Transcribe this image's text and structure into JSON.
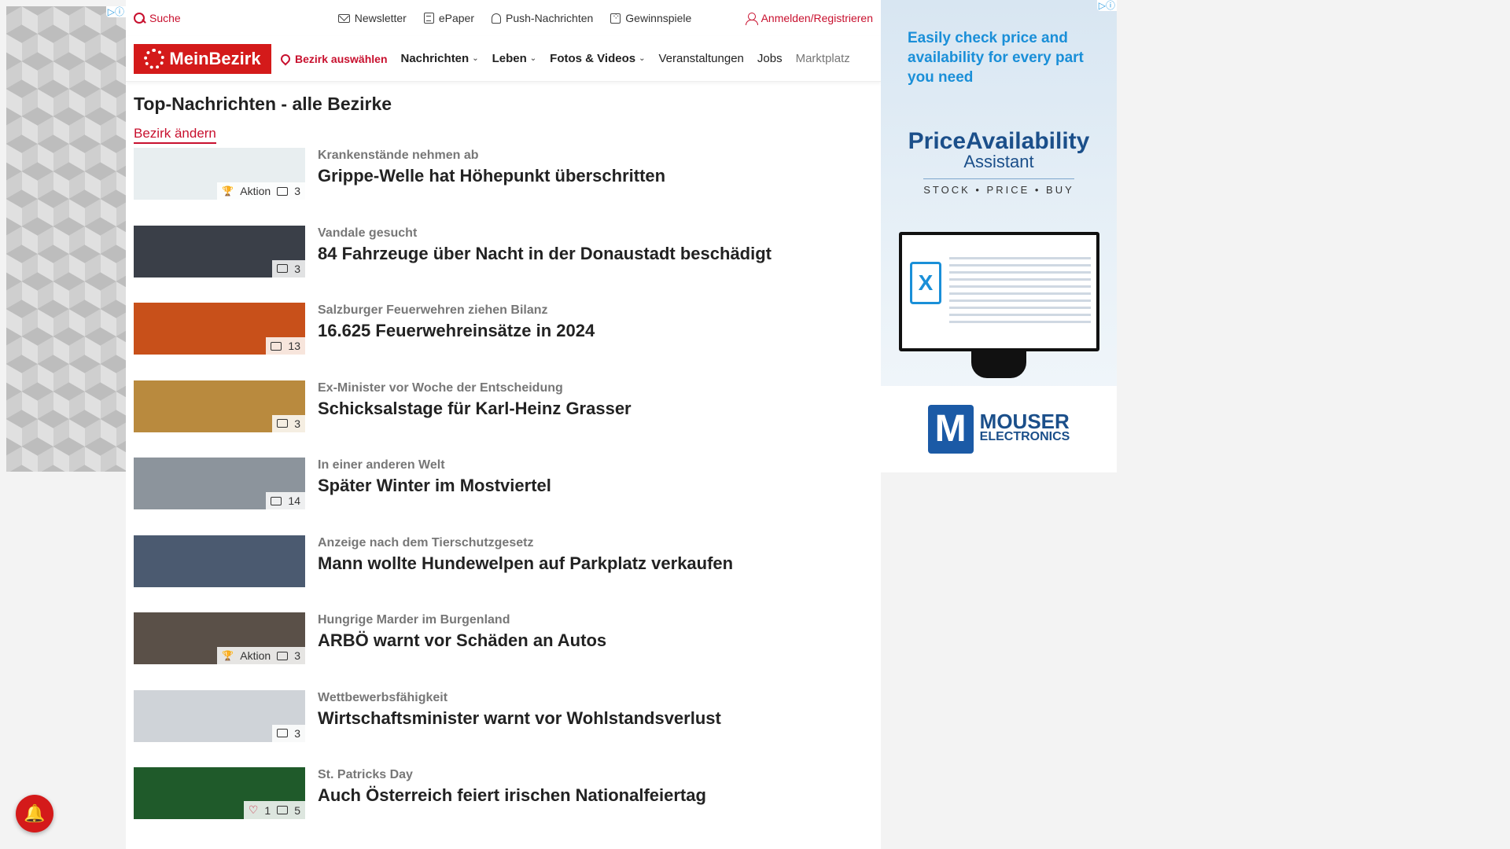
{
  "ads": {
    "left_choices": "▷ⓘ",
    "right_choices": "▷ⓘ",
    "right": {
      "tagline": "Easily check price and availability for every part you need",
      "logo_line1": "PriceAvailability",
      "logo_line2": "Assistant",
      "logo_sub": "STOCK • PRICE • BUY",
      "brand_mark": "M",
      "brand_name": "MOUSER",
      "brand_sub": "ELECTRONICS"
    }
  },
  "topbar": {
    "search": "Suche",
    "newsletter": "Newsletter",
    "epaper": "ePaper",
    "push": "Push-Nachrichten",
    "games": "Gewinnspiele",
    "login": "Anmelden/Registrieren"
  },
  "nav": {
    "logo": "MeinBezirk",
    "bezirk": "Bezirk auswählen",
    "items": [
      "Nachrichten",
      "Leben",
      "Fotos & Videos",
      "Veranstaltungen",
      "Jobs",
      "Marktplatz"
    ]
  },
  "page": {
    "title": "Top-Nachrichten - alle Bezirke",
    "change_link": "Bezirk ändern"
  },
  "articles": [
    {
      "kicker": "Krankenstände nehmen ab",
      "headline": "Grippe-Welle hat Höhepunkt überschritten",
      "aktion": "Aktion",
      "count": "3",
      "color": "#e8eef0"
    },
    {
      "kicker": "Vandale gesucht",
      "headline": "84 Fahrzeuge über Nacht in der Donaustadt beschädigt",
      "count": "3",
      "color": "#3a3f48"
    },
    {
      "kicker": "Salzburger Feuerwehren ziehen Bilanz",
      "headline": "16.625 Feuerwehreinsätze in 2024",
      "count": "13",
      "color": "#c8501a"
    },
    {
      "kicker": "Ex-Minister vor Woche der Entscheidung",
      "headline": "Schicksalstage für Karl-Heinz Grasser",
      "count": "3",
      "color": "#b98a3e"
    },
    {
      "kicker": "In einer anderen Welt",
      "headline": "Später Winter im Mostviertel",
      "count": "14",
      "color": "#8c949c"
    },
    {
      "kicker": "Anzeige nach dem Tierschutzgesetz",
      "headline": "Mann wollte Hundewelpen auf Parkplatz verkaufen",
      "count": "",
      "color": "#4b5a70"
    },
    {
      "kicker": "Hungrige Marder im Burgenland",
      "headline": "ARBÖ warnt vor Schäden an Autos",
      "aktion": "Aktion",
      "count": "3",
      "color": "#5a5048"
    },
    {
      "kicker": "Wettbewerbsfähigkeit",
      "headline": "Wirtschaftsminister warnt vor Wohlstandsverlust",
      "count": "3",
      "color": "#cfd3d8"
    },
    {
      "kicker": "St. Patricks Day",
      "headline": "Auch Österreich feiert irischen Nationalfeiertag",
      "likes": "1",
      "count": "5",
      "color": "#1f5a2a"
    }
  ],
  "colors": {
    "brand": "#d41a1a",
    "accent": "#c8102e"
  }
}
